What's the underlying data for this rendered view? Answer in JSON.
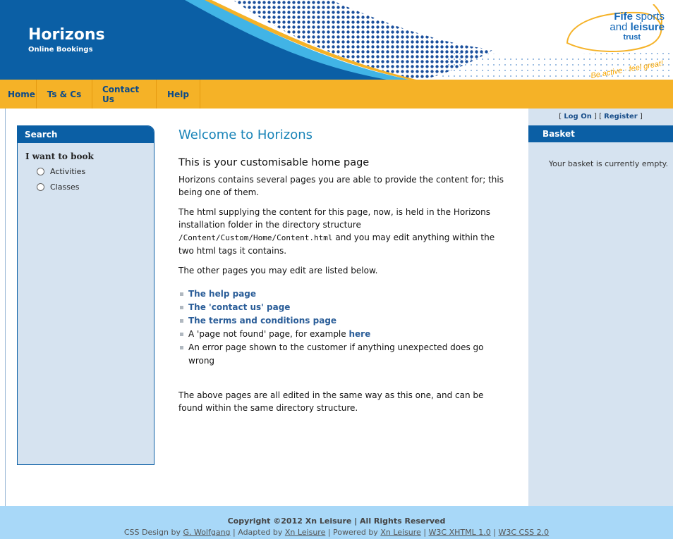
{
  "header": {
    "title": "Horizons",
    "subtitle": "Online Bookings",
    "logo": {
      "line1_a": "Fife",
      "line1_b": " sports",
      "line2_a": "and ",
      "line2_b": "leisure",
      "line3": "trust",
      "tagline": "Be active · feel great!"
    }
  },
  "nav": {
    "items": [
      {
        "label": "Home"
      },
      {
        "label": "Ts & Cs"
      },
      {
        "label": "Contact Us"
      },
      {
        "label": "Help"
      }
    ]
  },
  "account": {
    "log_on": "Log On",
    "register": "Register"
  },
  "search": {
    "heading": "Search",
    "prompt": "I want to book",
    "options": [
      {
        "label": "Activities",
        "selected": false
      },
      {
        "label": "Classes",
        "selected": false
      }
    ]
  },
  "main": {
    "title": "Welcome to Horizons",
    "subtitle": "This is your customisable home page",
    "para1": "Horizons contains several pages you are able to provide the content for; this being one of them.",
    "para2_a": "The html supplying the content for this page, now, is held in the Horizons installation folder in the directory structure ",
    "para2_code": "/Content/Custom/Home/Content.html",
    "para2_b": " and you may edit anything within the two html tags it contains.",
    "para3": "The other pages you may edit are listed below.",
    "links": {
      "help": "The help page",
      "contact": "The 'contact us' page",
      "terms": "The terms and conditions page",
      "notfound_text": "A 'page not found' page, for example ",
      "notfound_link": "here",
      "error_text": "An error page shown to the customer if anything unexpected does go wrong"
    },
    "para4": "The above pages are all edited in the same way as this one, and can be found within the same directory structure."
  },
  "basket": {
    "heading": "Basket",
    "empty_text": "Your basket is currently empty."
  },
  "footer": {
    "copyright": "Copyright ©2012 Xn Leisure | All Rights Reserved",
    "design_prefix": "CSS Design by ",
    "designer": "G. Wolfgang",
    "adapted_prefix": " | Adapted by ",
    "adapter": "Xn Leisure",
    "powered_prefix": " | Powered by ",
    "powered": "Xn Leisure",
    "sep1": " | ",
    "xhtml": "W3C XHTML 1.0",
    "sep2": " | ",
    "css": "W3C CSS 2.0"
  },
  "colors": {
    "header_blue": "#0b5fa5",
    "nav_orange": "#f5b227",
    "panel_bg": "#d6e3f0",
    "title_teal": "#1a84b8",
    "footer_bg": "#a8d8f8"
  }
}
